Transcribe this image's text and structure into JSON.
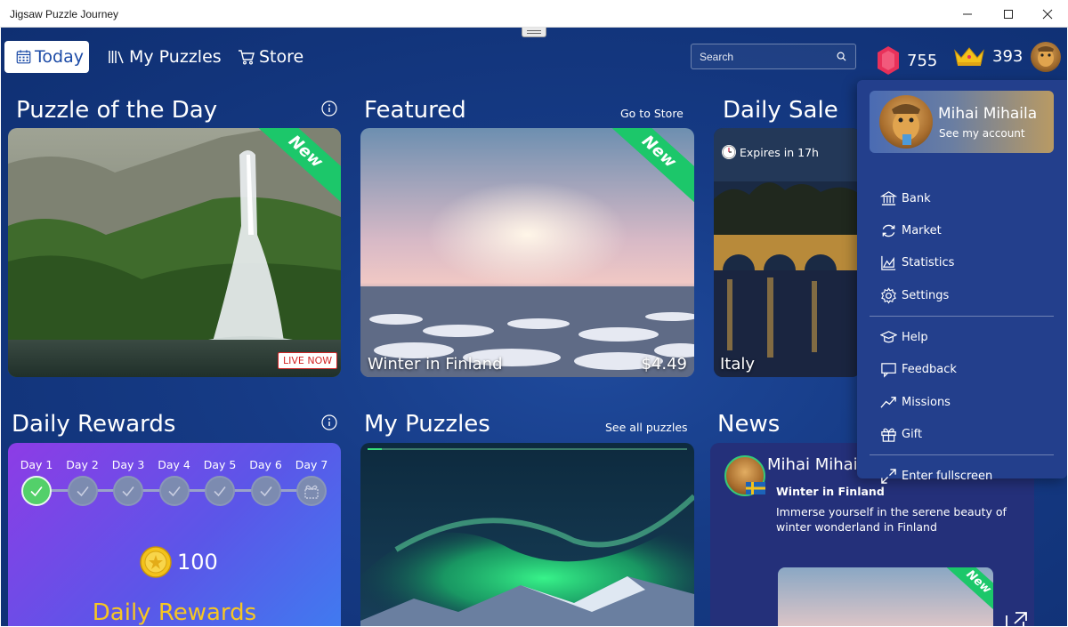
{
  "window": {
    "title": "Jigsaw Puzzle Journey"
  },
  "nav": {
    "today": "Today",
    "my_puzzles": "My Puzzles",
    "store": "Store"
  },
  "search": {
    "placeholder": "Search"
  },
  "currency": {
    "gems": "755",
    "crowns": "393"
  },
  "sections": {
    "pod": {
      "title": "Puzzle of the Day",
      "badge": "New",
      "live": "LIVE NOW"
    },
    "featured": {
      "title": "Featured",
      "link": "Go to Store",
      "badge": "New",
      "name": "Winter in Finland",
      "price": "$4.49"
    },
    "sale": {
      "title": "Daily Sale",
      "expires": "Expires in 17h",
      "name": "Italy"
    },
    "rewards": {
      "title": "Daily Rewards",
      "days": [
        "Day 1",
        "Day 2",
        "Day 3",
        "Day 4",
        "Day 5",
        "Day 6",
        "Day 7"
      ],
      "coins": "100",
      "banner": "Daily Rewards"
    },
    "mypuzzles": {
      "title": "My Puzzles",
      "link": "See all puzzles"
    },
    "news": {
      "title": "News",
      "author": "Mihai Mihail",
      "headline": "Winter in Finland",
      "body": "Immerse yourself in the serene beauty of winter wonderland in Finland",
      "badge": "New"
    }
  },
  "menu": {
    "name": "Mihai Mihaila",
    "account": "See my account",
    "items": [
      "Bank",
      "Market",
      "Statistics",
      "Settings",
      "Help",
      "Feedback",
      "Missions",
      "Gift",
      "Enter fullscreen"
    ]
  },
  "colors": {
    "accent": "#1cc76a",
    "gem": "#e8315a",
    "crown": "#f3c21b",
    "bg": "#163b86"
  }
}
